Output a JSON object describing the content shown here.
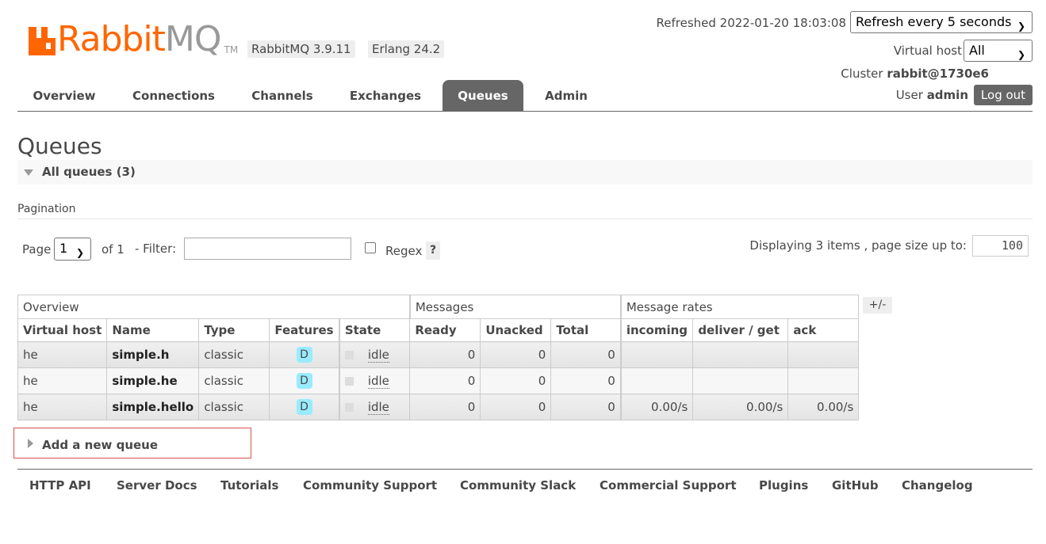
{
  "brand": {
    "rabbit": "Rabbit",
    "mq": "MQ",
    "tm": "TM"
  },
  "versions": {
    "rabbitmq": "RabbitMQ 3.9.11",
    "erlang": "Erlang 24.2"
  },
  "header": {
    "refreshed": "Refreshed 2022-01-20 18:03:08",
    "refresh_option": "Refresh every 5 seconds",
    "vhost_label": "Virtual host",
    "vhost_value": "All",
    "cluster_label": "Cluster",
    "cluster_value": "rabbit@1730e6",
    "user_label": "User",
    "user_value": "admin",
    "logout": "Log out"
  },
  "nav": {
    "tabs": [
      "Overview",
      "Connections",
      "Channels",
      "Exchanges",
      "Queues",
      "Admin"
    ],
    "active": "Queues"
  },
  "page": {
    "title": "Queues",
    "section": "All queues (3)",
    "pagination_label": "Pagination",
    "page_label": "Page",
    "page_value": "1",
    "of_label": "of 1",
    "filter_label": "- Filter:",
    "filter_value": "",
    "regex_label": "Regex",
    "regex_help": "?",
    "displaying": "Displaying 3 items , page size up to:",
    "page_size": "100"
  },
  "table": {
    "groups": [
      "Overview",
      "Messages",
      "Message rates"
    ],
    "columns": [
      "Virtual host",
      "Name",
      "Type",
      "Features",
      "State",
      "Ready",
      "Unacked",
      "Total",
      "incoming",
      "deliver / get",
      "ack"
    ],
    "toggle": "+/-",
    "rows": [
      {
        "vhost": "he",
        "name": "simple.h",
        "type": "classic",
        "feature": "D",
        "state": "idle",
        "ready": "0",
        "unacked": "0",
        "total": "0",
        "incoming": "",
        "deliver": "",
        "ack": ""
      },
      {
        "vhost": "he",
        "name": "simple.he",
        "type": "classic",
        "feature": "D",
        "state": "idle",
        "ready": "0",
        "unacked": "0",
        "total": "0",
        "incoming": "",
        "deliver": "",
        "ack": ""
      },
      {
        "vhost": "he",
        "name": "simple.hello",
        "type": "classic",
        "feature": "D",
        "state": "idle",
        "ready": "0",
        "unacked": "0",
        "total": "0",
        "incoming": "0.00/s",
        "deliver": "0.00/s",
        "ack": "0.00/s"
      }
    ]
  },
  "add_queue": "Add a new queue",
  "footer": [
    "HTTP API",
    "Server Docs",
    "Tutorials",
    "Community Support",
    "Community Slack",
    "Commercial Support",
    "Plugins",
    "GitHub",
    "Changelog"
  ],
  "colors": {
    "brand": "#ff6600",
    "active_tab": "#666666",
    "feature_badge": "#99ebff",
    "highlight_border": "#d9534f"
  }
}
